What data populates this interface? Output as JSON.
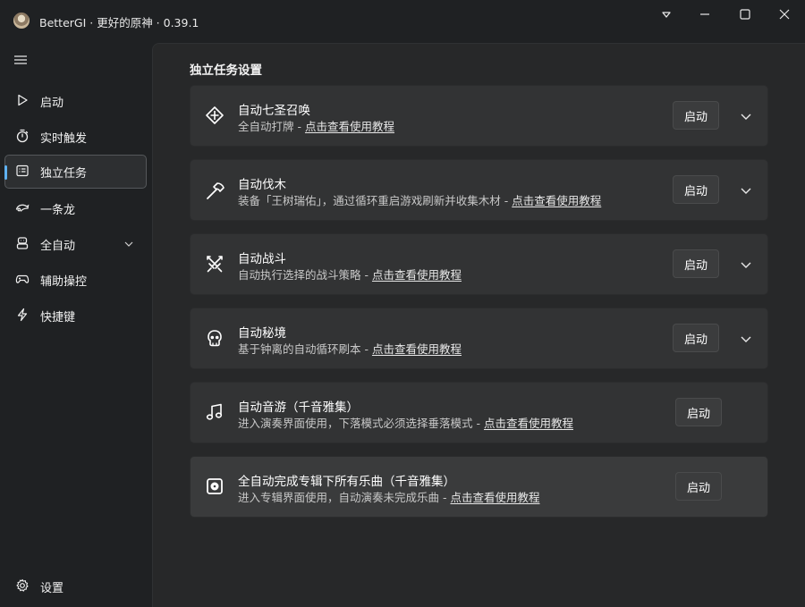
{
  "app": {
    "title": "BetterGI · 更好的原神 · 0.39.1",
    "icons": [
      "app-avatar-icon",
      "dropdown-caret-icon",
      "minimize-icon",
      "maximize-icon",
      "close-icon"
    ]
  },
  "sidebar": {
    "menu_icon": "hamburger-icon",
    "items": [
      {
        "label": "启动",
        "icon": "play-icon"
      },
      {
        "label": "实时触发",
        "icon": "stopwatch-icon"
      },
      {
        "label": "独立任务",
        "icon": "task-icon",
        "active": true
      },
      {
        "label": "一条龙",
        "icon": "dragon-icon"
      },
      {
        "label": "全自动",
        "icon": "robot-icon",
        "expandable": true
      },
      {
        "label": "辅助操控",
        "icon": "gamepad-icon"
      },
      {
        "label": "快捷键",
        "icon": "lightning-icon"
      }
    ],
    "footer": {
      "label": "设置",
      "icon": "gear-icon"
    }
  },
  "main": {
    "section_title": "独立任务设置",
    "start_label": "启动",
    "cards": [
      {
        "title": "自动七圣召唤",
        "desc": "全自动打牌 - ",
        "link": "点击查看使用教程",
        "icon": "card-game-icon",
        "expandable": true
      },
      {
        "title": "自动伐木",
        "desc": "装备「王树瑞佑」，通过循环重启游戏刷新并收集木材 - ",
        "link": "点击查看使用教程",
        "icon": "axe-icon",
        "expandable": true
      },
      {
        "title": "自动战斗",
        "desc": "自动执行选择的战斗策略 - ",
        "link": "点击查看使用教程",
        "icon": "crossed-swords-icon",
        "expandable": true
      },
      {
        "title": "自动秘境",
        "desc": "基于钟离的自动循环刷本 - ",
        "link": "点击查看使用教程",
        "icon": "skull-icon",
        "expandable": true
      },
      {
        "title": "自动音游（千音雅集）",
        "desc": "进入演奏界面使用，下落模式必须选择垂落模式 - ",
        "link": "点击查看使用教程",
        "icon": "music-note-icon",
        "expandable": false
      },
      {
        "title": "全自动完成专辑下所有乐曲（千音雅集）",
        "desc": "进入专辑界面使用，自动演奏未完成乐曲 - ",
        "link": "点击查看使用教程",
        "icon": "album-icon",
        "expandable": false
      }
    ]
  },
  "colors": {
    "accent": "#5fb2f2",
    "background": "#1f2123",
    "content": "#272829",
    "card": "#323334"
  }
}
